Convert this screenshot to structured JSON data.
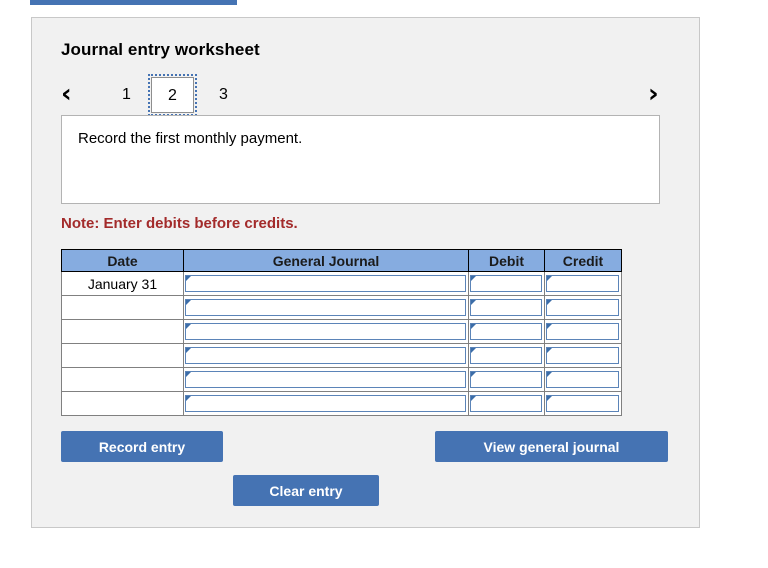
{
  "top_tab": {
    "name": "cut-off-tab",
    "color": "#4573b3"
  },
  "panel": {
    "title": "Journal entry worksheet",
    "background": "#f1f1f1",
    "border_color": "#c8c8c8"
  },
  "pager": {
    "prev_icon": "‹",
    "next_icon": "›",
    "pages": [
      {
        "label": "1",
        "selected": false
      },
      {
        "label": "2",
        "selected": true
      },
      {
        "label": "3",
        "selected": false
      }
    ]
  },
  "description": {
    "text": "Record the first monthly payment."
  },
  "note": {
    "text": "Note: Enter debits before credits.",
    "color": "#a32b2b"
  },
  "table": {
    "header_color": "#86ace0",
    "columns": [
      "Date",
      "General Journal",
      "Debit",
      "Credit"
    ],
    "rows": [
      {
        "date": "January 31",
        "general_journal": "",
        "debit": "",
        "credit": ""
      },
      {
        "date": "",
        "general_journal": "",
        "debit": "",
        "credit": ""
      },
      {
        "date": "",
        "general_journal": "",
        "debit": "",
        "credit": ""
      },
      {
        "date": "",
        "general_journal": "",
        "debit": "",
        "credit": ""
      },
      {
        "date": "",
        "general_journal": "",
        "debit": "",
        "credit": ""
      },
      {
        "date": "",
        "general_journal": "",
        "debit": "",
        "credit": ""
      }
    ]
  },
  "buttons": {
    "record_entry": "Record entry",
    "view_general_journal": "View general journal",
    "clear_entry": "Clear entry",
    "color": "#4573b3"
  }
}
